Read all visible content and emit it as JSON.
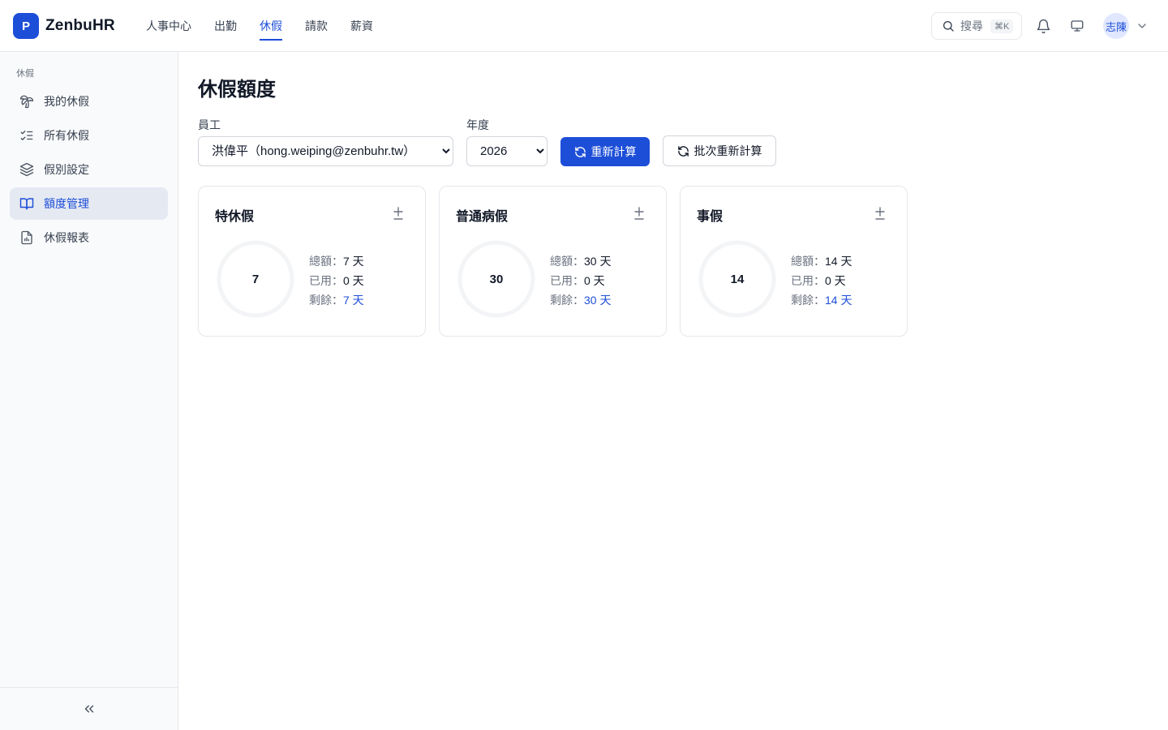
{
  "brand": {
    "logo_letter": "P",
    "name": "ZenbuHR"
  },
  "topnav": [
    {
      "label": "人事中心",
      "active": false
    },
    {
      "label": "出勤",
      "active": false
    },
    {
      "label": "休假",
      "active": true
    },
    {
      "label": "請款",
      "active": false
    },
    {
      "label": "薪資",
      "active": false
    }
  ],
  "search": {
    "label": "搜尋",
    "shortcut": "⌘K"
  },
  "user": {
    "avatar_text": "志陳"
  },
  "sidebar": {
    "section": "休假",
    "items": [
      {
        "label": "我的休假",
        "icon": "palm-tree-icon",
        "active": false
      },
      {
        "label": "所有休假",
        "icon": "list-checks-icon",
        "active": false
      },
      {
        "label": "假別設定",
        "icon": "layers-icon",
        "active": false
      },
      {
        "label": "額度管理",
        "icon": "book-open-icon",
        "active": true
      },
      {
        "label": "休假報表",
        "icon": "report-file-icon",
        "active": false
      }
    ],
    "collapse_icon": "chevrons-left-icon"
  },
  "page": {
    "title": "休假額度",
    "employee_label": "員工",
    "employee_value": "洪偉平（hong.weiping@zenbuhr.tw）",
    "year_label": "年度",
    "year_value": "2026",
    "recalc_label": "重新計算",
    "batch_recalc_label": "批次重新計算"
  },
  "colors": {
    "accent": "#1d4ed8",
    "border": "#e5e7eb",
    "sidebar_bg": "#f9fafb",
    "active_bg": "#e5e9f2"
  },
  "cards": [
    {
      "title": "特休假",
      "center": "7",
      "total_label": "總額：",
      "total": "7 天",
      "used_label": "已用：",
      "used": "0 天",
      "remain_label": "剩餘：",
      "remain": "7 天",
      "used_fraction": 0
    },
    {
      "title": "普通病假",
      "center": "30",
      "total_label": "總額：",
      "total": "30 天",
      "used_label": "已用：",
      "used": "0 天",
      "remain_label": "剩餘：",
      "remain": "30 天",
      "used_fraction": 0
    },
    {
      "title": "事假",
      "center": "14",
      "total_label": "總額：",
      "total": "14 天",
      "used_label": "已用：",
      "used": "0 天",
      "remain_label": "剩餘：",
      "remain": "14 天",
      "used_fraction": 0
    }
  ]
}
